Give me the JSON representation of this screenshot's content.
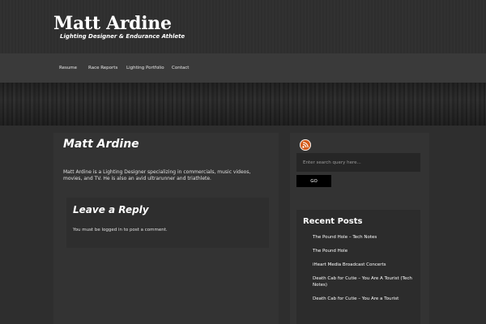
{
  "site": {
    "title": "Matt Ardine",
    "tagline": "Lighting Designer & Endurance Athlete"
  },
  "nav": {
    "items": [
      {
        "label": "Resume"
      },
      {
        "label": "Race Reports"
      },
      {
        "label": "Lighting Portfolio"
      },
      {
        "label": "Contact"
      }
    ]
  },
  "main": {
    "title": "Matt Ardine",
    "body": "Matt Ardine is a Lighting Designer specializing in commercials, music videos, movies, and TV.  He is also an avid ultrarunner and triathlete.",
    "reply": {
      "title": "Leave a Reply",
      "note": "You must be logged in to post a comment."
    }
  },
  "sidebar": {
    "rss_icon": "rss-icon",
    "search": {
      "placeholder": "Enter search query here...",
      "button_label": "GO"
    },
    "recent_posts": {
      "title": "Recent Posts",
      "items": [
        {
          "label": "The Pound Hole – Tech Notes"
        },
        {
          "label": "The Pound Hole"
        },
        {
          "label": "iHeart Media Broadcast Concerts"
        },
        {
          "label": "Death Cab for Cutie – You Are A Tourist (Tech Notes)"
        },
        {
          "label": "Death Cab for Cutie – You Are a Tourist"
        }
      ]
    }
  },
  "colors": {
    "background": "#2e2e2e",
    "nav_bar": "#3a3a3a",
    "panel": "#333333",
    "rss_accent": "#d45a1a",
    "button": "#000000"
  }
}
